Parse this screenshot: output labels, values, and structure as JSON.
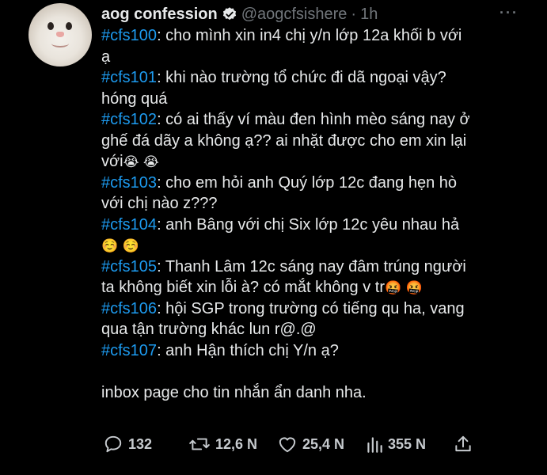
{
  "account": {
    "name": "aog confession",
    "handle": "@aogcfsishere",
    "separator": "·",
    "time": "1h",
    "more": "···"
  },
  "tweet": {
    "lines": [
      {
        "tag": "#cfs100",
        "text": ": cho mình xin in4 chị y/n lớp 12a khối b với"
      },
      {
        "tag": "",
        "text": "ạ"
      },
      {
        "tag": "#cfs101",
        "text": ": khi nào trường tổ chức đi dã ngoại vậy?"
      },
      {
        "tag": "",
        "text": "hóng quá"
      },
      {
        "tag": "#cfs102",
        "text": ": có ai thấy ví màu đen hình mèo sáng nay ở"
      },
      {
        "tag": "",
        "text": "ghế đá dãy a không ạ?? ai nhặt được cho em xin lại"
      },
      {
        "tag": "",
        "text": "với",
        "emoji": "😭 😭"
      },
      {
        "tag": "#cfs103",
        "text": ": cho em hỏi anh Quý lớp 12c đang hẹn hò"
      },
      {
        "tag": "",
        "text": "với chị nào z???"
      },
      {
        "tag": "#cfs104",
        "text": ": anh Bâng với chị Six lớp 12c yêu nhau hả"
      },
      {
        "tag": "",
        "text": "",
        "emoji": "☺️ ☺️"
      },
      {
        "tag": "#cfs105",
        "text": ": Thanh Lâm 12c sáng nay đâm trúng người"
      },
      {
        "tag": "",
        "text": "ta không biết xin lỗi à? có mắt không v tr",
        "emoji": "🤬 🤬"
      },
      {
        "tag": "#cfs106",
        "text": ": hội SGP trong trường có tiếng qu ha, vang"
      },
      {
        "tag": "",
        "text": "qua tận trường khác lun r@.@"
      },
      {
        "tag": "#cfs107",
        "text": ": anh Hận thích chị Y/n ạ?"
      }
    ],
    "footer": "inbox page cho tin nhắn ẩn danh nha."
  },
  "stats": {
    "replies": "132",
    "retweets": "12,6 N",
    "likes": "25,4 N",
    "views": "355 N"
  },
  "colors": {
    "background": "#000000",
    "text": "#e7e9ea",
    "muted": "#71767b",
    "accent": "#1d9bf0"
  },
  "icons": [
    "verified-badge-icon",
    "more-icon",
    "reply-icon",
    "retweet-icon",
    "like-icon",
    "views-icon",
    "share-icon"
  ]
}
